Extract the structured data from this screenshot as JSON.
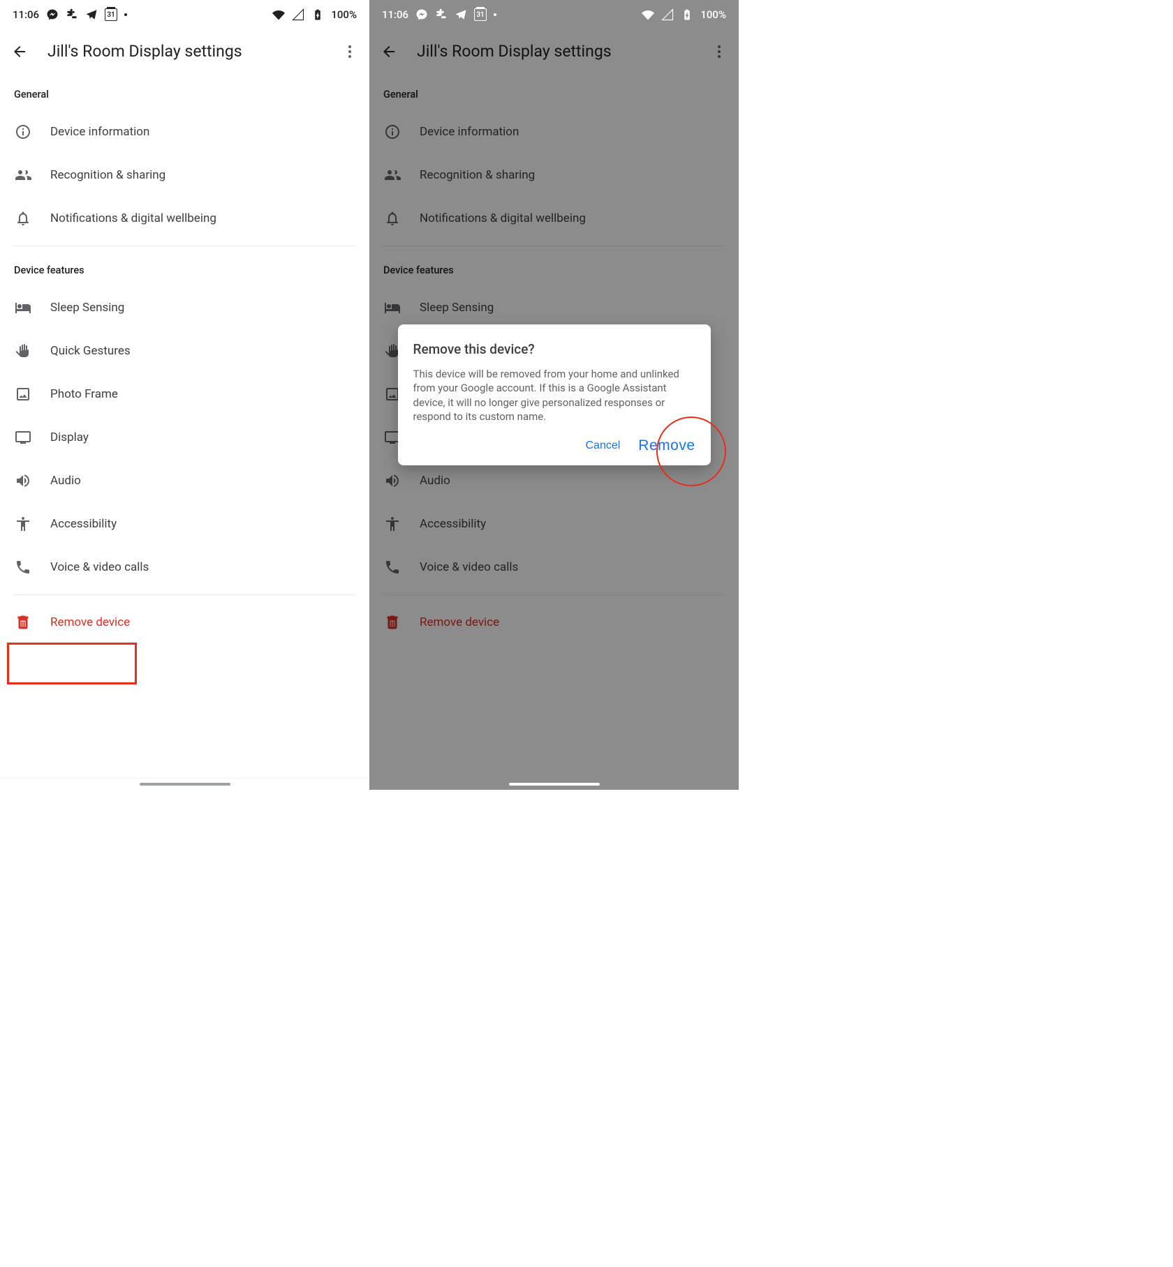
{
  "status": {
    "time": "11:06",
    "calendar_day": "31",
    "battery": "100%"
  },
  "appbar": {
    "title": "Jill's Room Display settings"
  },
  "sections": {
    "general": {
      "label": "General",
      "items": [
        {
          "label": "Device information"
        },
        {
          "label": "Recognition & sharing"
        },
        {
          "label": "Notifications & digital wellbeing"
        }
      ]
    },
    "features": {
      "label": "Device features",
      "items": [
        {
          "label": "Sleep Sensing"
        },
        {
          "label": "Quick Gestures"
        },
        {
          "label": "Photo Frame"
        },
        {
          "label": "Display"
        },
        {
          "label": "Audio"
        },
        {
          "label": "Accessibility"
        },
        {
          "label": "Voice & video calls"
        }
      ]
    },
    "remove": {
      "label": "Remove device"
    }
  },
  "dialog": {
    "title": "Remove this device?",
    "body": "This device will be removed from your home and unlinked from your Google account. If this is a Google Assistant device, it will no longer give personalized responses or respond to its custom name.",
    "cancel": "Cancel",
    "confirm": "Remove"
  }
}
